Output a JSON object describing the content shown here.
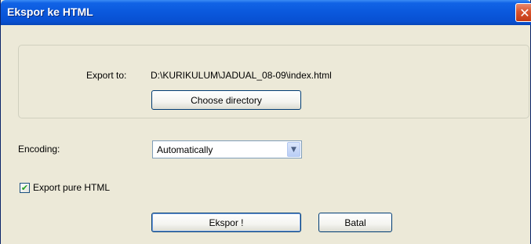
{
  "window": {
    "title": "Ekspor ke HTML",
    "close_glyph": "✕"
  },
  "export": {
    "label": "Export to:",
    "path": "D:\\KURIKULUM\\JADUAL_08-09\\index.html",
    "choose_button": "Choose directory"
  },
  "encoding": {
    "label": "Encoding:",
    "selected": "Automatically",
    "arrow_icon": "chevron-down-icon"
  },
  "options": {
    "pure_html_label": "Export pure HTML",
    "pure_html_checked": true,
    "check_glyph": "✔"
  },
  "actions": {
    "ok_label": "Ekspor !",
    "cancel_label": "Batal"
  }
}
